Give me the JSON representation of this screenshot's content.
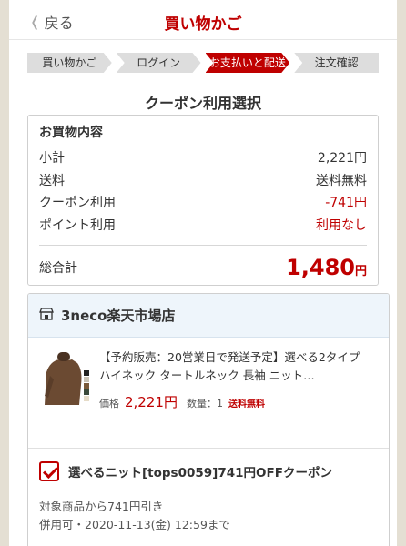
{
  "header": {
    "back_label": "戻る",
    "title": "買い物かご"
  },
  "steps": [
    "買い物かご",
    "ログイン",
    "お支払いと配送",
    "注文確認"
  ],
  "section_title": "クーポン利用選択",
  "summary": {
    "heading": "お買物内容",
    "rows": [
      {
        "label": "小計",
        "value": "2,221円"
      },
      {
        "label": "送料",
        "value": "送料無料"
      },
      {
        "label": "クーポン利用",
        "value": "-741円"
      },
      {
        "label": "ポイント利用",
        "value": "利用なし"
      }
    ],
    "total_label": "総合計",
    "total_amount": "1,480",
    "total_unit": "円"
  },
  "shop": {
    "name": "3neco楽天市場店",
    "item": {
      "name": "【予約販売：20営業日で発送予定】選べる2タイプ　ハイネック タートルネック 長袖 ニット…",
      "price_label": "価格",
      "price": "2,221円",
      "quantity": "数量：1",
      "shipping": "送料無料"
    },
    "coupon": {
      "name": "選べるニット[tops0059]741円OFFクーポン",
      "desc1": "対象商品から741円引き",
      "desc2": "併用可・2020-11-13(金) 12:59まで"
    }
  },
  "colors": {
    "accent": "#bf0000",
    "shop_header_bg": "#eef5fb",
    "step_inactive": "#dddddd",
    "outer_bg": "#e4dfd3"
  }
}
